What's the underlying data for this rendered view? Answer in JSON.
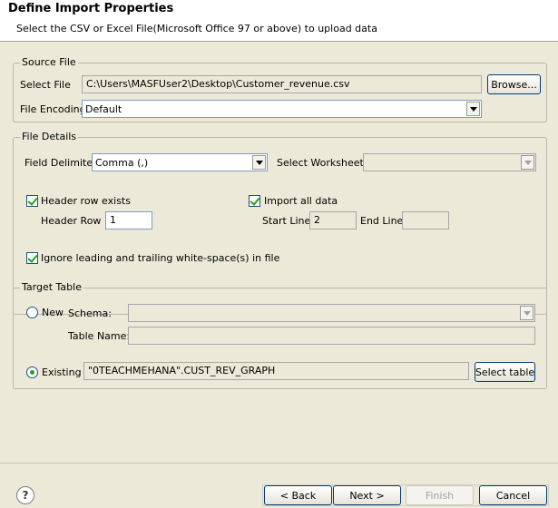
{
  "header": {
    "title": "Define Import Properties",
    "subtitle": "Select the CSV or Excel File(Microsoft Office 97 or above) to upload data"
  },
  "source_file": {
    "legend": "Source File",
    "select_file_label": "Select File",
    "select_file_value": "C:\\Users\\MASFUser2\\Desktop\\Customer_revenue.csv",
    "browse_label": "Browse...",
    "encoding_label": "File Encoding",
    "encoding_value": "Default"
  },
  "file_details": {
    "legend": "File Details",
    "delimiter_label": "Field Delimiter",
    "delimiter_value": "Comma (,)",
    "worksheet_label": "Select Worksheet:",
    "worksheet_value": "",
    "header_row_exists_label": "Header row exists",
    "header_row_exists_checked": true,
    "header_row_label": "Header Row :",
    "header_row_value": "1",
    "import_all_label": "Import all data",
    "import_all_checked": true,
    "start_line_label": "Start Line",
    "start_line_value": "2",
    "end_line_label": "End Line",
    "end_line_value": "",
    "ignore_ws_label": "Ignore leading and trailing white-space(s) in file",
    "ignore_ws_checked": true
  },
  "target_table": {
    "legend": "Target Table",
    "new_label": "New",
    "schema_label": "Schema:",
    "schema_value": "",
    "table_name_label": "Table Name:",
    "table_name_value": "",
    "existing_label": "Existing",
    "existing_value": "\"0TEACHMEHANA\".CUST_REV_GRAPH",
    "select_table_label": "Select table",
    "selected_option": "existing"
  },
  "footer": {
    "help_icon": "?",
    "back_label": "< Back",
    "next_label": "Next >",
    "finish_label": "Finish",
    "cancel_label": "Cancel"
  }
}
